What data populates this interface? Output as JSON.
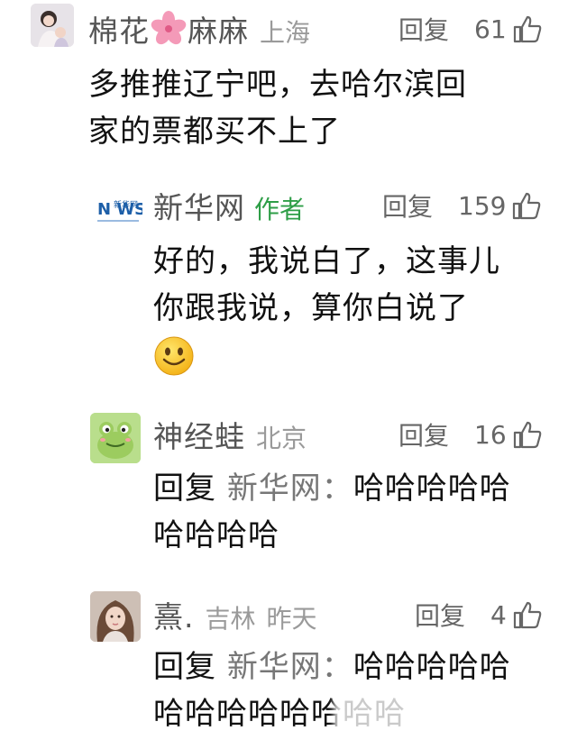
{
  "comments": [
    {
      "name_part1": "棉花",
      "name_part2": "麻麻",
      "location": "上海",
      "reply_label": "回复",
      "likes": "61",
      "text_line1": "多推推辽宁吧，去哈尔滨回",
      "text_line2": "家的票都买不上了",
      "icons": {
        "avatar": "avatar-woman-child",
        "name_emoji": "cherry-blossom-icon",
        "like": "thumbs-up-icon"
      }
    },
    {
      "name": "新华网",
      "author_tag": "作者",
      "reply_label": "回复",
      "likes": "159",
      "text_line1": "好的，我说白了，这事儿",
      "text_line2": "你跟我说，算你白说了",
      "logo_text": "新华网",
      "logo_letters": "N WS",
      "icons": {
        "avatar": "xinhua-news-logo",
        "emoji": "smile-emoji-icon",
        "like": "thumbs-up-icon"
      }
    },
    {
      "name": "神经蛙",
      "location": "北京",
      "reply_label": "回复",
      "likes": "16",
      "reply_prefix": "回复",
      "reply_target": "新华网：",
      "text_line1_rest": "哈哈哈哈哈",
      "text_line2": "哈哈哈哈",
      "icons": {
        "avatar": "frog-avatar",
        "like": "thumbs-up-icon"
      }
    },
    {
      "name": "熹.",
      "location": "吉林",
      "time": "昨天",
      "reply_label": "回复",
      "likes": "4",
      "reply_prefix": "回复",
      "reply_target": "新华网：",
      "text_line1_rest": "哈哈哈哈哈",
      "text_line2": "哈哈哈哈哈哈哈哈",
      "icons": {
        "avatar": "girl-photo-avatar",
        "like": "thumbs-up-icon"
      }
    }
  ]
}
